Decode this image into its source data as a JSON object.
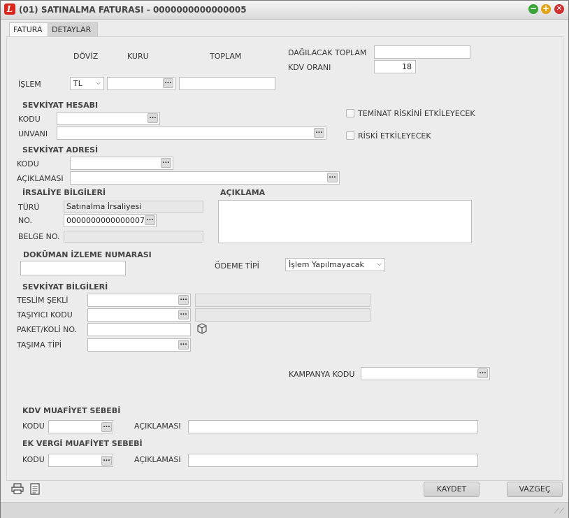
{
  "window": {
    "title": "(01) SATINALMA FATURASI - 0000000000000005",
    "icon_letter": "L"
  },
  "tabs": [
    {
      "label": "FATURA"
    },
    {
      "label": "DETAYLAR"
    }
  ],
  "currency": {
    "doviz_label": "DÖVİZ",
    "kuru_label": "KURU",
    "toplam_label": "TOPLAM",
    "islem_label": "İŞLEM",
    "doviz_value": "TL",
    "kuru_value": "",
    "toplam_value": ""
  },
  "distribution": {
    "dagilacak_label": "DAĞILACAK TOPLAM",
    "dagilacak_value": "",
    "kdv_label": "KDV ORANI",
    "kdv_value": "18"
  },
  "sevkiyat_hesabi": {
    "header": "SEVKİYAT HESABI",
    "kodu_label": "KODU",
    "kodu_value": "",
    "unvani_label": "UNVANI",
    "unvani_value": ""
  },
  "checkboxes": {
    "teminat": "TEMİNAT RİSKİNİ ETKİLEYECEK",
    "risk": "RİSKİ ETKİLEYECEK"
  },
  "sevkiyat_adresi": {
    "header": "SEVKİYAT ADRESİ",
    "kodu_label": "KODU",
    "kodu_value": "",
    "aciklama_label": "AÇIKLAMASI",
    "aciklama_value": ""
  },
  "irsaliye": {
    "header": "İRSALİYE BİLGİLERİ",
    "turu_label": "TÜRÜ",
    "turu_value": "Satınalma İrsaliyesi",
    "no_label": "NO.",
    "no_value": "0000000000000007",
    "belge_label": "BELGE NO.",
    "belge_value": ""
  },
  "aciklama": {
    "header": "AÇIKLAMA",
    "value": ""
  },
  "dokuman": {
    "header": "DOKÜMAN İZLEME NUMARASI",
    "value": ""
  },
  "odeme": {
    "label": "ÖDEME TİPİ",
    "value": "İşlem Yapılmayacak"
  },
  "sevkiyat_bilgileri": {
    "header": "SEVKİYAT BİLGİLERİ",
    "teslim_label": "TESLİM ŞEKLİ",
    "tasiyici_label": "TAŞIYICI KODU",
    "paket_label": "PAKET/KOLİ NO.",
    "tasima_label": "TAŞIMA TİPİ"
  },
  "kampanya": {
    "label": "KAMPANYA KODU",
    "value": ""
  },
  "kdv_muafiyet": {
    "header": "KDV MUAFİYET SEBEBİ",
    "kodu_label": "KODU",
    "aciklama_label": "AÇIKLAMASI"
  },
  "ek_vergi": {
    "header": "EK VERGİ MUAFİYET SEBEBİ",
    "kodu_label": "KODU",
    "aciklama_label": "AÇIKLAMASI"
  },
  "buttons": {
    "dots": "...",
    "save": "KAYDET",
    "cancel": "VAZGEÇ"
  },
  "icons": {
    "printer": "printer-icon",
    "document": "document-icon",
    "package": "package-icon"
  },
  "colors": {
    "app_icon": "#d9261c",
    "minimize": "#3aa33a",
    "maximize": "#e0a414",
    "close": "#d13030"
  }
}
